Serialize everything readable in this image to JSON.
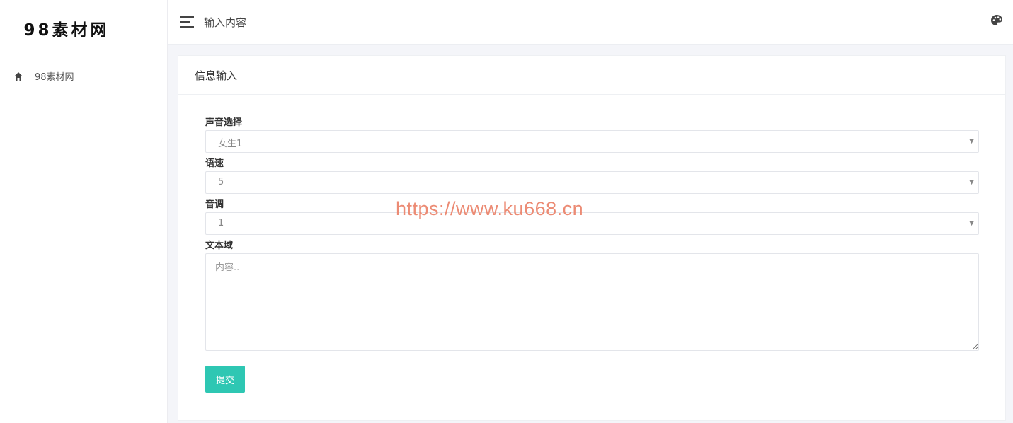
{
  "sidebar": {
    "logo": "98素材网",
    "items": [
      {
        "label": "98素材网",
        "icon": "home-icon"
      }
    ]
  },
  "topbar": {
    "title": "输入内容",
    "menu_icon": "hamburger-icon",
    "theme_icon": "palette-icon"
  },
  "card": {
    "title": "信息输入",
    "fields": {
      "voice": {
        "label": "声音选择",
        "value": "女生1"
      },
      "speed": {
        "label": "语速",
        "value": "5"
      },
      "pitch": {
        "label": "音调",
        "value": "1"
      },
      "text": {
        "label": "文本域",
        "placeholder": "内容.."
      }
    },
    "submit_label": "提交"
  },
  "watermark": "https://www.ku668.cn",
  "colors": {
    "accent": "#2ec7b3",
    "watermark": "#ec8b74",
    "background": "#f4f5f9"
  }
}
